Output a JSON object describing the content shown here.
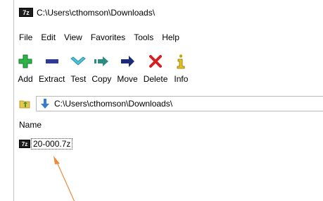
{
  "window": {
    "title": "C:\\Users\\cthomson\\Downloads\\",
    "app_icon_text": "7z"
  },
  "menu": [
    "File",
    "Edit",
    "View",
    "Favorites",
    "Tools",
    "Help"
  ],
  "toolbar": {
    "add": "Add",
    "extract": "Extract",
    "test": "Test",
    "copy": "Copy",
    "move": "Move",
    "delete": "Delete",
    "info": "Info"
  },
  "address": {
    "path": "C:\\Users\\cthomson\\Downloads\\"
  },
  "file_list": {
    "column_name": "Name",
    "files": [
      {
        "icon_text": "7z",
        "name": "20-000.7z"
      }
    ]
  },
  "colors": {
    "add": "#2db34a",
    "extract": "#2e3a9a",
    "test": "#4ec3d6",
    "copy": "#2d8c82",
    "move": "#1b2b7a",
    "delete": "#d42020",
    "info": "#c9a400",
    "annotation": "#f0883a"
  }
}
